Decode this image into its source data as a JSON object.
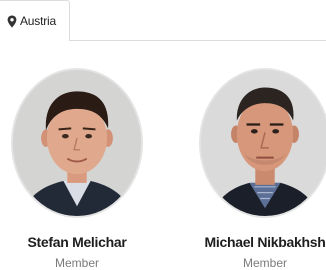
{
  "filter_tab": {
    "label": "Austria",
    "icon": "map-pin-icon"
  },
  "members": [
    {
      "name": "Stefan Melichar",
      "role": "Member"
    },
    {
      "name": "Michael Nikbakhsh",
      "role": "Member"
    }
  ],
  "colors": {
    "text_dark": "#1e1e1e",
    "text_muted": "#7a7a7a",
    "border": "#dcdcdc"
  }
}
